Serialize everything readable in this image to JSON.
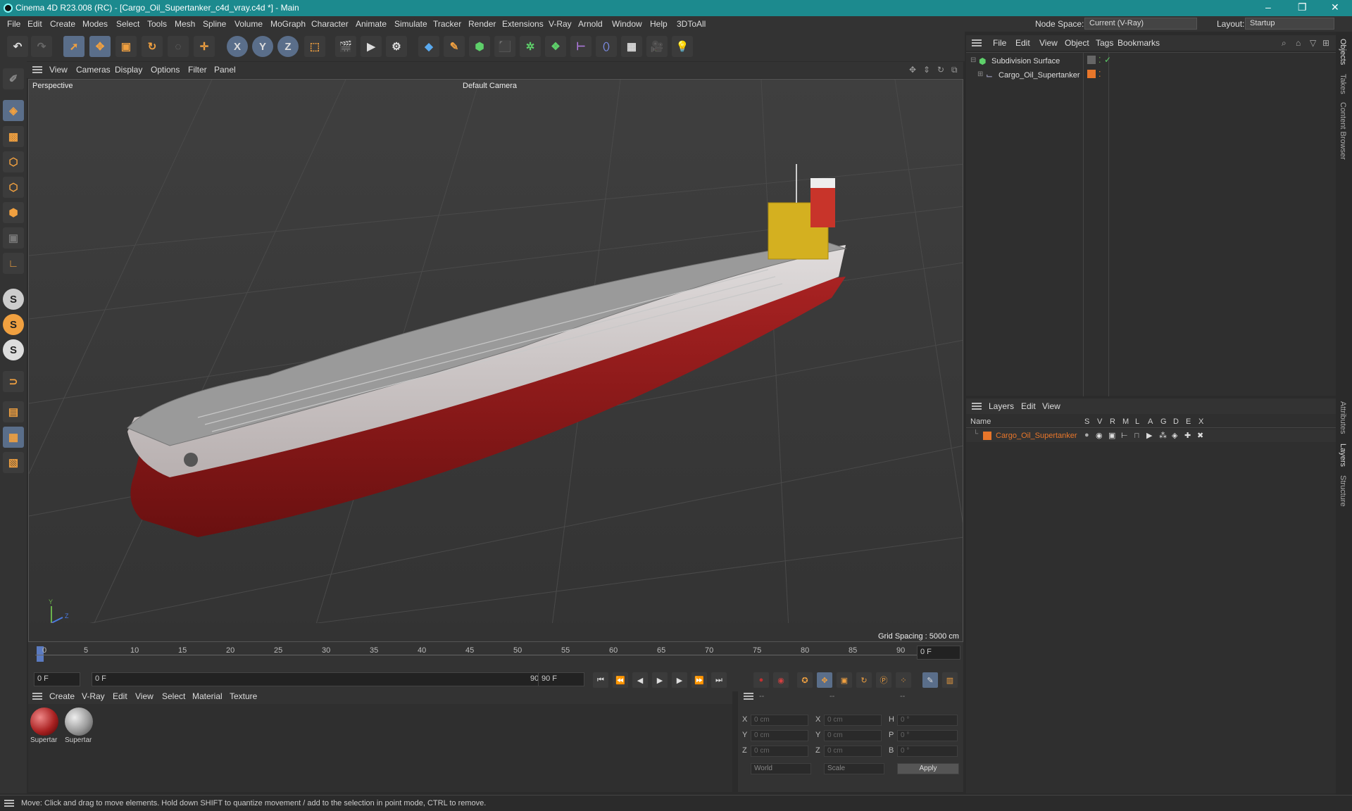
{
  "titlebar": {
    "title": "Cinema 4D R23.008 (RC) - [Cargo_Oil_Supertanker_c4d_vray.c4d *] - Main",
    "minimize": "–",
    "maximize": "❐",
    "close": "✕"
  },
  "menubar": {
    "items": [
      "File",
      "Edit",
      "Create",
      "Modes",
      "Select",
      "Tools",
      "Mesh",
      "Spline",
      "Volume",
      "MoGraph",
      "Character",
      "Animate",
      "Simulate",
      "Tracker",
      "Render",
      "Extensions",
      "V-Ray",
      "Arnold",
      "Window",
      "Help",
      "3DToAll"
    ],
    "node_space_label": "Node Space:",
    "node_space_value": "Current (V-Ray)",
    "layout_label": "Layout:",
    "layout_value": "Startup"
  },
  "toolbar": {
    "x": "X",
    "y": "Y",
    "z": "Z"
  },
  "left_tools": {
    "s1": "S",
    "s2": "S",
    "s3": "S"
  },
  "viewport": {
    "menu": [
      "View",
      "Cameras",
      "Display",
      "Options",
      "Filter",
      "Panel"
    ],
    "label": "Perspective",
    "camera": "Default Camera",
    "grid_spacing": "Grid Spacing : 5000 cm",
    "axis_y": "Y",
    "axis_z": "Z",
    "axis_x": "X"
  },
  "timeline": {
    "ticks": [
      "0",
      "5",
      "10",
      "15",
      "20",
      "25",
      "30",
      "35",
      "40",
      "45",
      "50",
      "55",
      "60",
      "65",
      "70",
      "75",
      "80",
      "85",
      "90"
    ],
    "current_frame": "0 F"
  },
  "transport": {
    "start": "0 F",
    "range_start": "0 F",
    "range_end": "90 F",
    "end": "90 F"
  },
  "materials": {
    "menu": [
      "Create",
      "V-Ray",
      "Edit",
      "View",
      "Select",
      "Material",
      "Texture"
    ],
    "items": [
      {
        "name": "Supertar"
      },
      {
        "name": "Supertar"
      }
    ]
  },
  "coords": {
    "head": [
      "--",
      "--",
      "--"
    ],
    "rows": [
      {
        "a": "X",
        "av": "0 cm",
        "b": "X",
        "bv": "0 cm",
        "c": "H",
        "cv": "0 °"
      },
      {
        "a": "Y",
        "av": "0 cm",
        "b": "Y",
        "bv": "0 cm",
        "c": "P",
        "cv": "0 °"
      },
      {
        "a": "Z",
        "av": "0 cm",
        "b": "Z",
        "bv": "0 cm",
        "c": "B",
        "cv": "0 °"
      }
    ],
    "mode1": "World",
    "mode2": "Scale",
    "apply": "Apply"
  },
  "objects": {
    "menu": [
      "File",
      "Edit",
      "View",
      "Object",
      "Tags",
      "Bookmarks"
    ],
    "items": [
      {
        "name": "Subdivision Surface"
      },
      {
        "name": "Cargo_Oil_Supertanker"
      }
    ]
  },
  "layers": {
    "menu": [
      "Layers",
      "Edit",
      "View"
    ],
    "columns": [
      "Name",
      "S",
      "V",
      "R",
      "M",
      "L",
      "A",
      "G",
      "D",
      "E",
      "X"
    ],
    "items": [
      {
        "name": "Cargo_Oil_Supertanker"
      }
    ]
  },
  "right_tabs": [
    "Objects",
    "Takes",
    "Content Browser",
    "Attributes",
    "Layers",
    "Structure"
  ],
  "status": "Move: Click and drag to move elements. Hold down SHIFT to quantize movement / add to the selection in point mode, CTRL to remove.",
  "colors": {
    "accent": "#1c8a8e",
    "orange": "#e8762a",
    "hull_red": "#8e1a1a"
  }
}
